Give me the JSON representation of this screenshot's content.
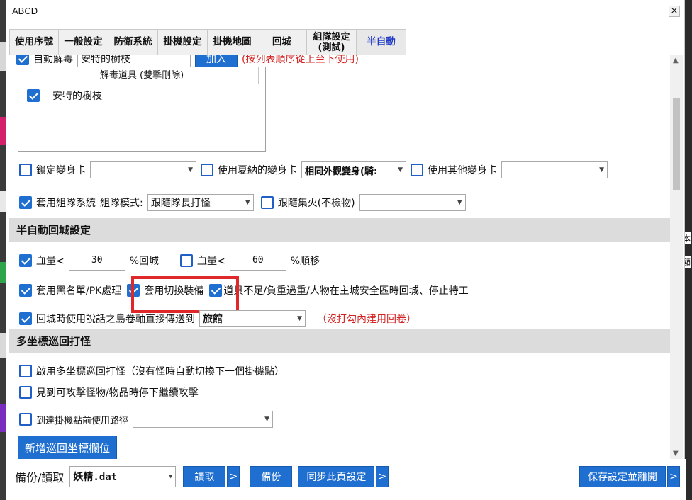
{
  "window": {
    "title": "ABCD",
    "close_glyph": "×"
  },
  "tabs": [
    {
      "label": "使用序號"
    },
    {
      "label": "一般設定"
    },
    {
      "label": "防衛系統"
    },
    {
      "label": "掛機設定"
    },
    {
      "label": "掛機地圖"
    },
    {
      "label": "回城"
    },
    {
      "label": "組隊設定\n(測試)"
    },
    {
      "label": "半自動",
      "active": true
    }
  ],
  "antidote": {
    "checkbox_label": "自動解毒",
    "input_value": "安特的樹枝",
    "add_button": "加入",
    "note": "(按列表順序從上至下使用)",
    "list_header": "解毒道具 (雙擊刪除)",
    "items": [
      {
        "label": "安特的樹枝",
        "checked": true
      }
    ]
  },
  "transform": {
    "lock_card_label": "鎖定變身卡",
    "lock_card_value": "",
    "xiana_label": "使用夏納的變身卡",
    "xiana_value": "相同外觀變身(騎:",
    "other_label": "使用其他變身卡",
    "other_value": ""
  },
  "party": {
    "use_party_label": "套用組隊系統",
    "mode_label": "組隊模式:",
    "mode_value": "跟隨隊長打怪",
    "follow_fire_label": "跟隨集火(不檢物)",
    "follow_fire_value": ""
  },
  "return_section": {
    "title": "半自動回城設定",
    "hp1_label": "血量<",
    "hp1_value": "30",
    "hp1_suffix": "%回城",
    "hp2_label": "血量<",
    "hp2_value": "60",
    "hp2_suffix": "%順移",
    "blacklist_label": "套用黑名單/PK處理",
    "switch_equip_label": "套用切換裝備",
    "shortage_label": "道具不足/負重過重/人物在主城安全區時回城、停止特工",
    "scroll_label": "回城時使用說話之島卷軸直接傳送到",
    "scroll_target": "旅館",
    "scroll_note": "（沒打勾內建用回卷）"
  },
  "patrol_section": {
    "title": "多坐標巡回打怪",
    "enable_label": "啟用多坐標巡回打怪（沒有怪時自動切換下一個掛機點）",
    "stop_label": "見到可攻擊怪物/物品時停下繼續攻擊",
    "path_label": "到達掛機點前使用路徑",
    "path_value": "",
    "add_button": "新增巡回坐標欄位"
  },
  "bottom": {
    "backup_label": "備份/讀取",
    "file_value": "妖精.dat",
    "read_button": "讀取",
    "more_glyph": ">",
    "backup_button": "備份",
    "sync_button": "同步此頁設定",
    "save_exit_button": "保存設定並離開"
  },
  "colors": {
    "accent": "#1f6fd1",
    "highlight": "#e0282a",
    "note_red": "#d42222"
  }
}
